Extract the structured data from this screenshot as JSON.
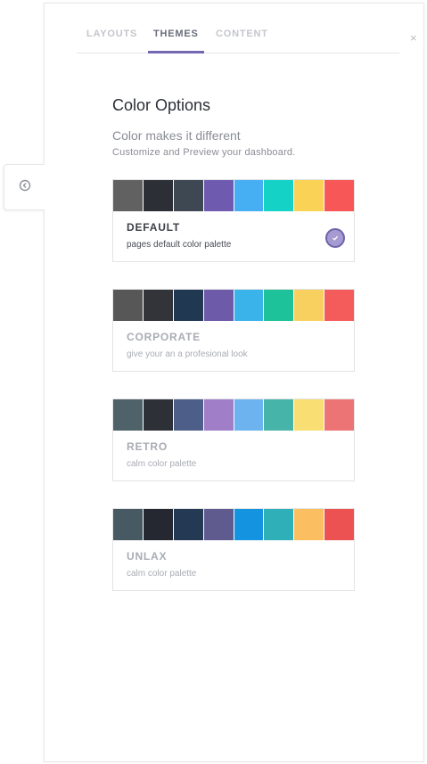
{
  "tabs": [
    {
      "label": "LAYOUTS"
    },
    {
      "label": "THEMES"
    },
    {
      "label": "CONTENT"
    }
  ],
  "close_label": "×",
  "heading": "Color Options",
  "subheading": "Color makes it different",
  "description": "Customize and Preview your dashboard.",
  "themes": [
    {
      "name": "DEFAULT",
      "description": "pages default color palette",
      "selected": true,
      "colors": [
        "#616161",
        "#2c2f36",
        "#3d4852",
        "#6e5bb0",
        "#46aef3",
        "#14d2c6",
        "#f9d256",
        "#f75757"
      ]
    },
    {
      "name": "CORPORATE",
      "description": "give your an a profesional look",
      "selected": false,
      "colors": [
        "#575757",
        "#333439",
        "#203852",
        "#6d5ba9",
        "#3ab3ea",
        "#1ec29a",
        "#f8d05f",
        "#f45c5c"
      ]
    },
    {
      "name": "RETRO",
      "description": "calm color palette",
      "selected": false,
      "colors": [
        "#4f6269",
        "#2d3137",
        "#4d5e88",
        "#a07ec8",
        "#6cb3f0",
        "#47b4aa",
        "#f9df73",
        "#ec7474"
      ]
    },
    {
      "name": "UNLAX",
      "description": "calm color palette",
      "selected": false,
      "colors": [
        "#475a63",
        "#252830",
        "#233954",
        "#605b8f",
        "#1393e0",
        "#2fb0b9",
        "#fbbe61",
        "#ec5252"
      ]
    }
  ]
}
